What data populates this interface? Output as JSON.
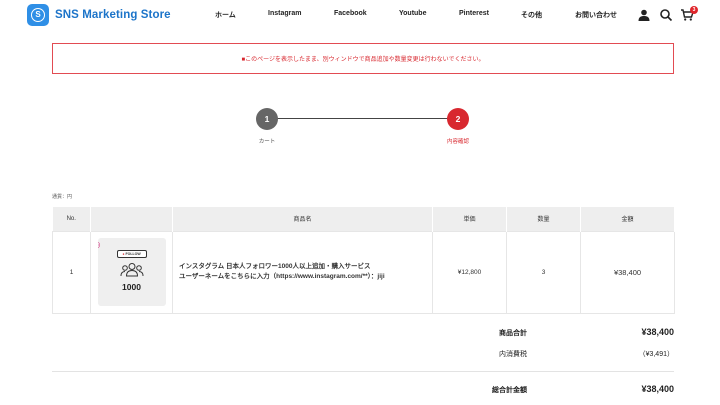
{
  "header": {
    "logo_text": "SNS Marketing Store",
    "nav": [
      "ホーム",
      "Instagram",
      "Facebook",
      "Youtube",
      "Pinterest",
      "その他",
      "お問い合わせ"
    ],
    "cart_count": "3"
  },
  "notice": "■このページを表示したまま、別ウィンドウで商品追加や数量変更は行わないでください。",
  "steps": [
    {
      "number": "1",
      "label": "カート"
    },
    {
      "number": "2",
      "label": "内容確認"
    }
  ],
  "currency_note": "通貨：円",
  "table": {
    "headers": [
      "No.",
      "",
      "商品名",
      "単価",
      "数量",
      "金額"
    ],
    "rows": [
      {
        "no": "1",
        "thumb_tag": "FOLLOW",
        "thumb_count": "1000",
        "name_line1": "インスタグラム 日本人フォロワー1000人以上追加・購入サービス",
        "name_line2": "ユーザーネームをこちらに入力（https://www.instagram.com/**）：jiji",
        "unit_price": "¥12,800",
        "quantity": "3",
        "amount": "¥38,400"
      }
    ]
  },
  "summary": {
    "subtotal_label": "商品合計",
    "subtotal_value": "¥38,400",
    "tax_label": "内消費税",
    "tax_value": "（¥3,491）",
    "total_label": "総合計金額",
    "total_value": "¥38,400"
  },
  "colors": {
    "brand": "#2f8fe6",
    "accent_red": "#d8282f",
    "step_inactive": "#666666"
  }
}
